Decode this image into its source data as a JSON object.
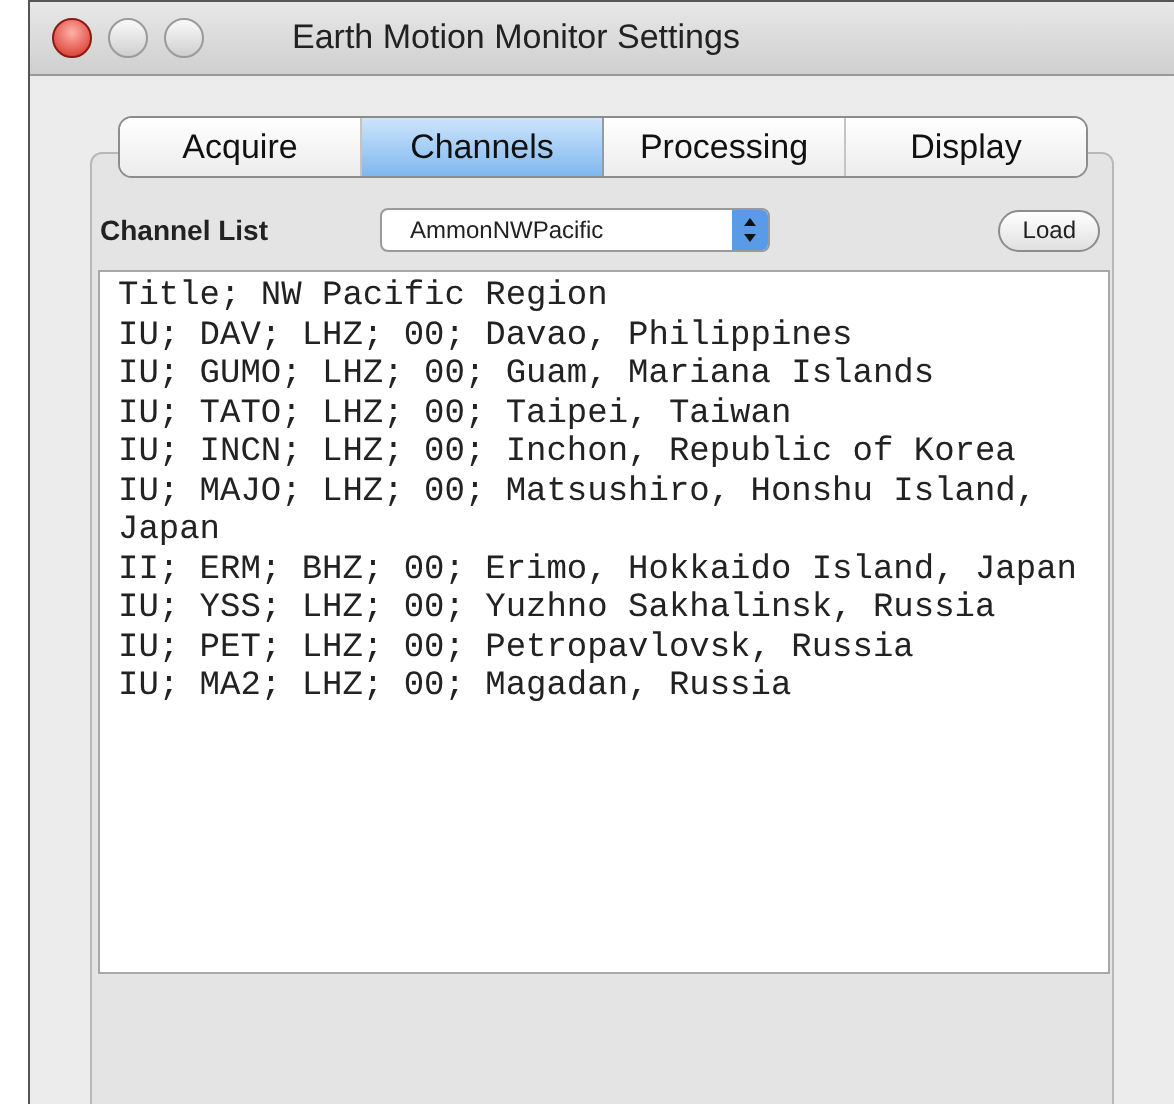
{
  "window": {
    "title": "Earth Motion Monitor Settings"
  },
  "tabs": [
    {
      "label": "Acquire",
      "selected": false
    },
    {
      "label": "Channels",
      "selected": true
    },
    {
      "label": "Processing",
      "selected": false
    },
    {
      "label": "Display",
      "selected": false
    }
  ],
  "channel_list": {
    "label": "Channel List",
    "value": "AmmonNWPacific",
    "button": "Load"
  },
  "lines": [
    "Title; NW Pacific Region",
    "IU; DAV; LHZ; 00; Davao, Philippines",
    "IU; GUMO; LHZ; 00; Guam, Mariana Islands",
    "IU; TATO; LHZ; 00; Taipei, Taiwan",
    "IU; INCN; LHZ; 00; Inchon, Republic of Korea",
    "IU; MAJO; LHZ; 00; Matsushiro, Honshu Island, Japan",
    "II; ERM; BHZ; 00; Erimo, Hokkaido Island, Japan",
    "IU; YSS; LHZ; 00; Yuzhno Sakhalinsk, Russia",
    "IU; PET; LHZ; 00; Petropavlovsk, Russia",
    "IU; MA2; LHZ; 00; Magadan, Russia"
  ]
}
